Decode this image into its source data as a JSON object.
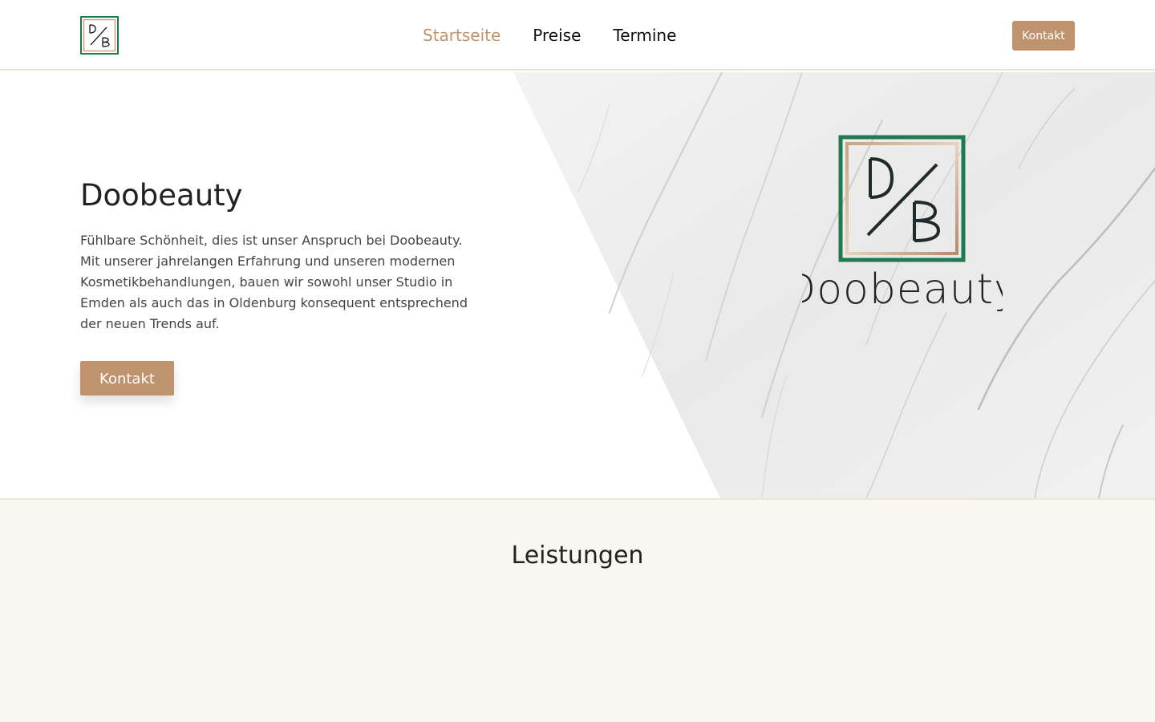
{
  "header": {
    "logo_text": "D/B",
    "nav": [
      {
        "label": "Startseite",
        "active": true
      },
      {
        "label": "Preise",
        "active": false
      },
      {
        "label": "Termine",
        "active": false
      }
    ],
    "contact_button": "Kontakt"
  },
  "hero": {
    "title": "Doobeauty",
    "text": "Fühlbare Schönheit, dies ist unser Anspruch bei Doobeauty. Mit unserer jahrelangen Erfahrung und unseren modernen Kosmetikbehandlungen, bauen wir sowohl unser Studio in Emden als auch das in Oldenburg konsequent entsprechend der neuen Trends auf.",
    "button": "Kontakt",
    "logo_wordmark": "Doobeauty",
    "logo_monogram": "D/B"
  },
  "services": {
    "title": "Leistungen"
  },
  "colors": {
    "accent": "#c0936f",
    "logo_green": "#1f7a4f",
    "cream": "#faf6f1"
  }
}
